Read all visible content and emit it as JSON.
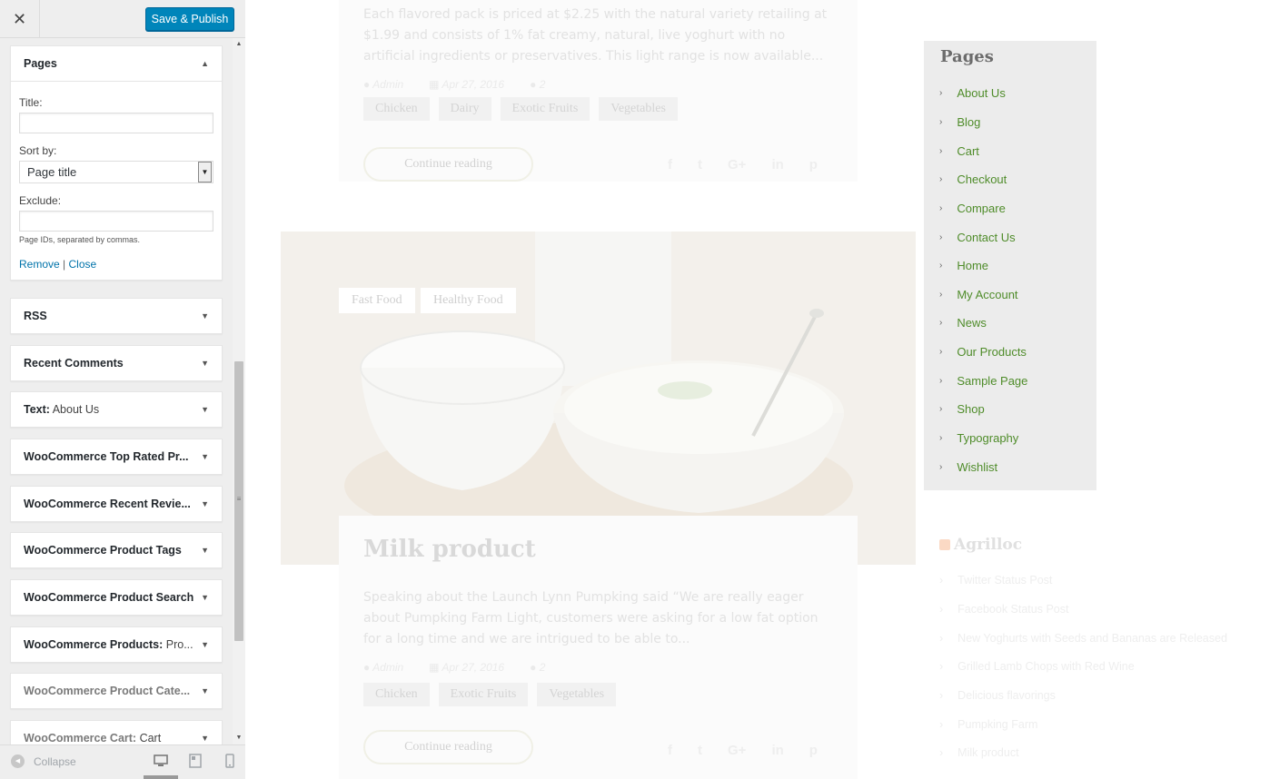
{
  "topbar": {
    "close_symbol": "✕",
    "publish_label": "Save & Publish"
  },
  "pages_widget": {
    "title": "Pages",
    "title_label": "Title:",
    "title_value": "",
    "sort_label": "Sort by:",
    "sort_value": "Page title",
    "exclude_label": "Exclude:",
    "exclude_value": "",
    "hint": "Page IDs, separated by commas.",
    "remove_label": "Remove",
    "separator": "|",
    "close_label": "Close"
  },
  "widgets": [
    {
      "label": "RSS",
      "sub": ""
    },
    {
      "label": "Recent Comments",
      "sub": ""
    },
    {
      "label": "Text:",
      "sub": " About Us"
    },
    {
      "label": "WooCommerce Top Rated Pr...",
      "sub": ""
    },
    {
      "label": "WooCommerce Recent Revie...",
      "sub": ""
    },
    {
      "label": "WooCommerce Product Tags",
      "sub": ""
    },
    {
      "label": "WooCommerce Product Search",
      "sub": ""
    },
    {
      "label": "WooCommerce Products:",
      "sub": " Pro..."
    },
    {
      "label": "WooCommerce Product Cate...",
      "sub": ""
    },
    {
      "label": "WooCommerce Cart:",
      "sub": " Cart"
    }
  ],
  "footer": {
    "collapse_label": "Collapse"
  },
  "preview": {
    "post1": {
      "excerpt": "Each flavored pack is priced at $2.25 with the natural variety retailing at $1.99 and consists of 1% fat creamy, natural, live yoghurt with no artificial ingredients or preservatives. This light range is now available...",
      "author": "Admin",
      "date": "Apr 27, 2016",
      "comments": "2",
      "tags": [
        "Chicken",
        "Dairy",
        "Exotic Fruits",
        "Vegetables"
      ],
      "read_more": "Continue reading"
    },
    "hero_tags": [
      "Fast Food",
      "Healthy Food"
    ],
    "post2": {
      "title": "Milk product",
      "excerpt": "Speaking about the Launch Lynn Pumpking said “We are really eager about Pumpking Farm Light, customers were asking for a low fat option for a long time and we are intrigued to be able to...",
      "author": "Admin",
      "date": "Apr 27, 2016",
      "comments": "2",
      "tags": [
        "Chicken",
        "Exotic Fruits",
        "Vegetables"
      ],
      "read_more": "Continue reading"
    },
    "social_icons": [
      "facebook-icon",
      "twitter-icon",
      "google-plus-icon",
      "linkedin-icon",
      "pinterest-icon"
    ],
    "pages": {
      "title": "Pages",
      "items": [
        "About Us",
        "Blog",
        "Cart",
        "Checkout",
        "Compare",
        "Contact Us",
        "Home",
        "My Account",
        "News",
        "Our Products",
        "Sample Page",
        "Shop",
        "Typography",
        "Wishlist"
      ]
    },
    "feed": {
      "title": "Agrilloc",
      "items": [
        "Twitter Status Post",
        "Facebook Status Post",
        "New Yoghurts with Seeds and Bananas are Released",
        "Grilled Lamb Chops with Red Wine",
        "Delicious flavorings",
        "Pumpking Farm",
        "Milk product"
      ]
    }
  },
  "colors": {
    "primary_button": "#0085ba",
    "link": "#0073aa",
    "page_link": "#4f8c2a"
  }
}
